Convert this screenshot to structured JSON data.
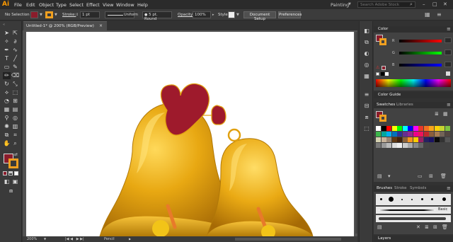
{
  "app": {
    "logo": "Ai",
    "workspace": "Painting",
    "search_placeholder": "Search Adobe Stock"
  },
  "menu": [
    "File",
    "Edit",
    "Object",
    "Type",
    "Select",
    "Effect",
    "View",
    "Window",
    "Help"
  ],
  "control_bar": {
    "selection": "No Selection",
    "stroke_label": "Stroke:",
    "stroke_weight": "1 pt",
    "profile": "Uniform",
    "brush": "5 pt. Round",
    "opacity_label": "Opacity:",
    "opacity_value": "100%",
    "style_label": "Style:",
    "document_setup": "Document Setup",
    "preferences": "Preferences",
    "fill_color": "#8a1c2b",
    "stroke_color": "#f0a020"
  },
  "document": {
    "tab": "Untitled-1* @ 200% (RGB/Preview)",
    "zoom": "200%",
    "current_tool": "Pencil"
  },
  "color_panel": {
    "title": "Color",
    "channels": [
      "R",
      "G",
      "B"
    ],
    "fill_color": "#8a1c2b"
  },
  "color_guide": {
    "title": "Color Guide"
  },
  "swatches_panel": {
    "tabs": [
      "Swatches",
      "Libraries"
    ]
  },
  "brushes_panel": {
    "tabs": [
      "Brushes",
      "Stroke",
      "Symbols"
    ],
    "basic_label": "Basic"
  },
  "layers_panel": {
    "title": "Layers"
  },
  "colors": {
    "bell": "#e8a812",
    "bell_dark": "#b07808",
    "bow": "#9e1a2c",
    "accent": "#ff9a00"
  }
}
